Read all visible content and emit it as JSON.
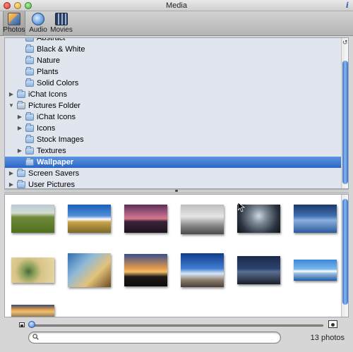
{
  "window": {
    "title": "Media",
    "info_glyph": "i"
  },
  "toolbar": {
    "tabs": [
      {
        "label": "Photos",
        "icon": "photos-icon",
        "active": true
      },
      {
        "label": "Audio",
        "icon": "audio-icon",
        "active": false
      },
      {
        "label": "Movies",
        "icon": "movies-icon",
        "active": false
      }
    ]
  },
  "tree": {
    "rows": [
      {
        "label": "Abstract",
        "indent": 2,
        "disclosure": "",
        "selected": false
      },
      {
        "label": "Black & White",
        "indent": 2,
        "disclosure": "",
        "selected": false
      },
      {
        "label": "Nature",
        "indent": 2,
        "disclosure": "",
        "selected": false
      },
      {
        "label": "Plants",
        "indent": 2,
        "disclosure": "",
        "selected": false
      },
      {
        "label": "Solid Colors",
        "indent": 2,
        "disclosure": "",
        "selected": false
      },
      {
        "label": "iChat Icons",
        "indent": 1,
        "disclosure": "▶",
        "selected": false
      },
      {
        "label": "Pictures Folder",
        "indent": 1,
        "disclosure": "▼",
        "selected": false
      },
      {
        "label": "iChat Icons",
        "indent": 2,
        "disclosure": "▶",
        "selected": false
      },
      {
        "label": "Icons",
        "indent": 2,
        "disclosure": "▶",
        "selected": false
      },
      {
        "label": "Stock Images",
        "indent": 2,
        "disclosure": "",
        "selected": false
      },
      {
        "label": "Textures",
        "indent": 2,
        "disclosure": "▶",
        "selected": false
      },
      {
        "label": "Wallpaper",
        "indent": 2,
        "disclosure": "",
        "selected": true
      },
      {
        "label": "Screen Savers",
        "indent": 1,
        "disclosure": "▶",
        "selected": false
      },
      {
        "label": "User Pictures",
        "indent": 1,
        "disclosure": "▶",
        "selected": false
      }
    ]
  },
  "photos": {
    "count_label": "13 photos",
    "items": [
      {
        "name": "green-hills",
        "bg": "linear-gradient(#b8c8d8 0%, #d4dccf 30%, #6f8a3a 45%, #50701e 100%)"
      },
      {
        "name": "blue-sky-field",
        "bg": "linear-gradient(#1b5fb8 0%, #4f8fd8 40%, #ffffff 52%, #c9a24a 62%, #7a6a2a 100%)"
      },
      {
        "name": "purple-sunset",
        "bg": "linear-gradient(#5b2f57 0%, #c06a8a 40%, #d6788a 50%, #3a2239 60%, #1e1520 100%)"
      },
      {
        "name": "bw-driftwood",
        "bg": "linear-gradient(#bdbdbd 0%, #e6e6e6 40%, #8a8a8a 70%, #4a4a4a 100%)"
      },
      {
        "name": "storm-clouds",
        "bg": "radial-gradient(circle at 50% 40%, #d0d8e0 0%, #7b8694 30%, #2b3340 70%, #0f1418 100%)"
      },
      {
        "name": "blue-lake",
        "bg": "linear-gradient(#1a3a6a 0%, #3e6fae 40%, #8ab0de 55%, #2e5a9a 100%)"
      },
      {
        "name": "beach-rocks",
        "bg": "radial-gradient(circle at 40% 55%, #4a6a3a 0%, #88a05a 20%, #d8c488 45%, #e7d9a6 100%)"
      },
      {
        "name": "dragonfly",
        "bg": "linear-gradient(135deg, #2f6fb2 0%, #8fb9d8 35%, #e3c27a 65%, #6b4a22 100%)"
      },
      {
        "name": "orange-sunset",
        "bg": "linear-gradient(#3a4f8a 0%, #e69a4a 45%, #f2c06a 55%, #1f1a18 70%, #0d0b0a 100%)"
      },
      {
        "name": "pier",
        "bg": "linear-gradient(#123a8a 0%, #3f7fd4 45%, #d7e6f4 60%, #8a7a6a 80%, #4a4038 100%)"
      },
      {
        "name": "bridge-night",
        "bg": "linear-gradient(#1b2a4a 0%, #2a4370 45%, #5a6f90 55%, #1a1e2a 100%)"
      },
      {
        "name": "snowy-mountain",
        "bg": "linear-gradient(#3a86d8 0%, #7ab8ee 45%, #ffffff 55%, #9ac0e0 65%, #1f5aa8 100%)"
      },
      {
        "name": "sunset-shore",
        "bg": "linear-gradient(#3a4a6a 0%, #e2a050 35%, #f0c070 50%, #6a5a4a 100%)"
      }
    ]
  },
  "search": {
    "placeholder": "",
    "value": ""
  },
  "slider": {
    "value": 0
  }
}
